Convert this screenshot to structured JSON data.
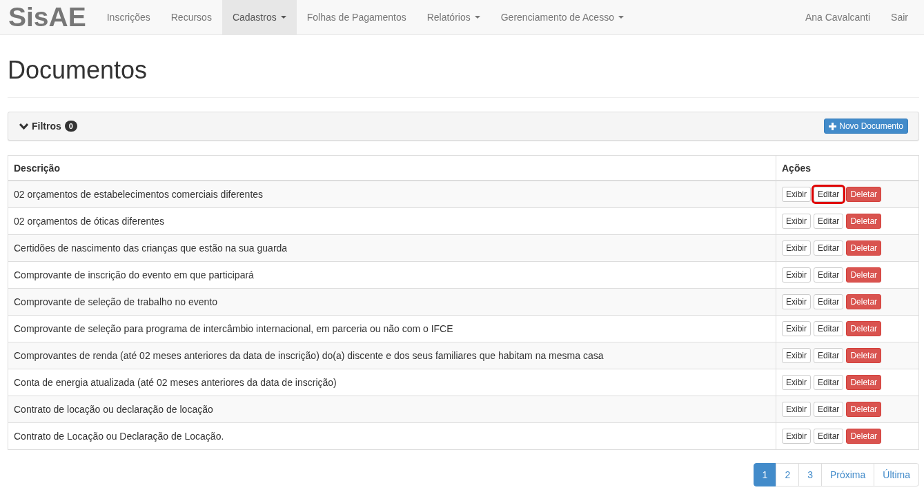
{
  "navbar": {
    "brand": "SisAE",
    "items": [
      {
        "label": "Inscrições",
        "dropdown": false,
        "selected": false
      },
      {
        "label": "Recursos",
        "dropdown": false,
        "selected": false
      },
      {
        "label": "Cadastros",
        "dropdown": true,
        "selected": true
      },
      {
        "label": "Folhas de Pagamentos",
        "dropdown": false,
        "selected": false
      },
      {
        "label": "Relatórios",
        "dropdown": true,
        "selected": false
      },
      {
        "label": "Gerenciamento de Acesso",
        "dropdown": true,
        "selected": false
      }
    ],
    "right_items": [
      "Ana Cavalcanti",
      "Sair"
    ]
  },
  "page_title": "Documentos",
  "filters": {
    "label": "Filtros",
    "count": "0",
    "expanded": true,
    "new_button": "Novo Documento"
  },
  "table": {
    "columns": [
      "Descrição",
      "Ações"
    ],
    "rows": [
      {
        "description": "02 orçamentos de estabelecimentos comerciais diferentes",
        "actions": [
          {
            "label": "Exibir",
            "kind": "default",
            "highlighted": false
          },
          {
            "label": "Editar",
            "kind": "default",
            "highlighted": true
          },
          {
            "label": "Deletar",
            "kind": "danger",
            "highlighted": false
          }
        ]
      },
      {
        "description": "02 orçamentos de óticas diferentes",
        "actions": [
          {
            "label": "Exibir",
            "kind": "default",
            "highlighted": false
          },
          {
            "label": "Editar",
            "kind": "default",
            "highlighted": false
          },
          {
            "label": "Deletar",
            "kind": "danger",
            "highlighted": false
          }
        ]
      },
      {
        "description": "Certidões de nascimento das crianças que estão na sua guarda",
        "actions": [
          {
            "label": "Exibir",
            "kind": "default",
            "highlighted": false
          },
          {
            "label": "Editar",
            "kind": "default",
            "highlighted": false
          },
          {
            "label": "Deletar",
            "kind": "danger",
            "highlighted": false
          }
        ]
      },
      {
        "description": "Comprovante de inscrição do evento em que participará",
        "actions": [
          {
            "label": "Exibir",
            "kind": "default",
            "highlighted": false
          },
          {
            "label": "Editar",
            "kind": "default",
            "highlighted": false
          },
          {
            "label": "Deletar",
            "kind": "danger",
            "highlighted": false
          }
        ]
      },
      {
        "description": "Comprovante de seleção de trabalho no evento",
        "actions": [
          {
            "label": "Exibir",
            "kind": "default",
            "highlighted": false
          },
          {
            "label": "Editar",
            "kind": "default",
            "highlighted": false
          },
          {
            "label": "Deletar",
            "kind": "danger",
            "highlighted": false
          }
        ]
      },
      {
        "description": "Comprovante de seleção para programa de intercâmbio internacional, em parceria ou não com o IFCE",
        "actions": [
          {
            "label": "Exibir",
            "kind": "default",
            "highlighted": false
          },
          {
            "label": "Editar",
            "kind": "default",
            "highlighted": false
          },
          {
            "label": "Deletar",
            "kind": "danger",
            "highlighted": false
          }
        ]
      },
      {
        "description": "Comprovantes de renda (até 02 meses anteriores da data de inscrição) do(a) discente e dos seus familiares que habitam na mesma casa",
        "actions": [
          {
            "label": "Exibir",
            "kind": "default",
            "highlighted": false
          },
          {
            "label": "Editar",
            "kind": "default",
            "highlighted": false
          },
          {
            "label": "Deletar",
            "kind": "danger",
            "highlighted": false
          }
        ]
      },
      {
        "description": "Conta de energia atualizada (até 02 meses anteriores da data de inscrição)",
        "actions": [
          {
            "label": "Exibir",
            "kind": "default",
            "highlighted": false
          },
          {
            "label": "Editar",
            "kind": "default",
            "highlighted": false
          },
          {
            "label": "Deletar",
            "kind": "danger",
            "highlighted": false
          }
        ]
      },
      {
        "description": "Contrato de locação ou declaração de locação",
        "actions": [
          {
            "label": "Exibir",
            "kind": "default",
            "highlighted": false
          },
          {
            "label": "Editar",
            "kind": "default",
            "highlighted": false
          },
          {
            "label": "Deletar",
            "kind": "danger",
            "highlighted": false
          }
        ]
      },
      {
        "description": "Contrato de Locação ou Declaração de Locação.",
        "actions": [
          {
            "label": "Exibir",
            "kind": "default",
            "highlighted": false
          },
          {
            "label": "Editar",
            "kind": "default",
            "highlighted": false
          },
          {
            "label": "Deletar",
            "kind": "danger",
            "highlighted": false
          }
        ]
      }
    ]
  },
  "pagination": [
    {
      "label": "1",
      "selected": true
    },
    {
      "label": "2",
      "selected": false
    },
    {
      "label": "3",
      "selected": false
    },
    {
      "label": "Próxima",
      "selected": false
    },
    {
      "label": "Última",
      "selected": false
    }
  ]
}
